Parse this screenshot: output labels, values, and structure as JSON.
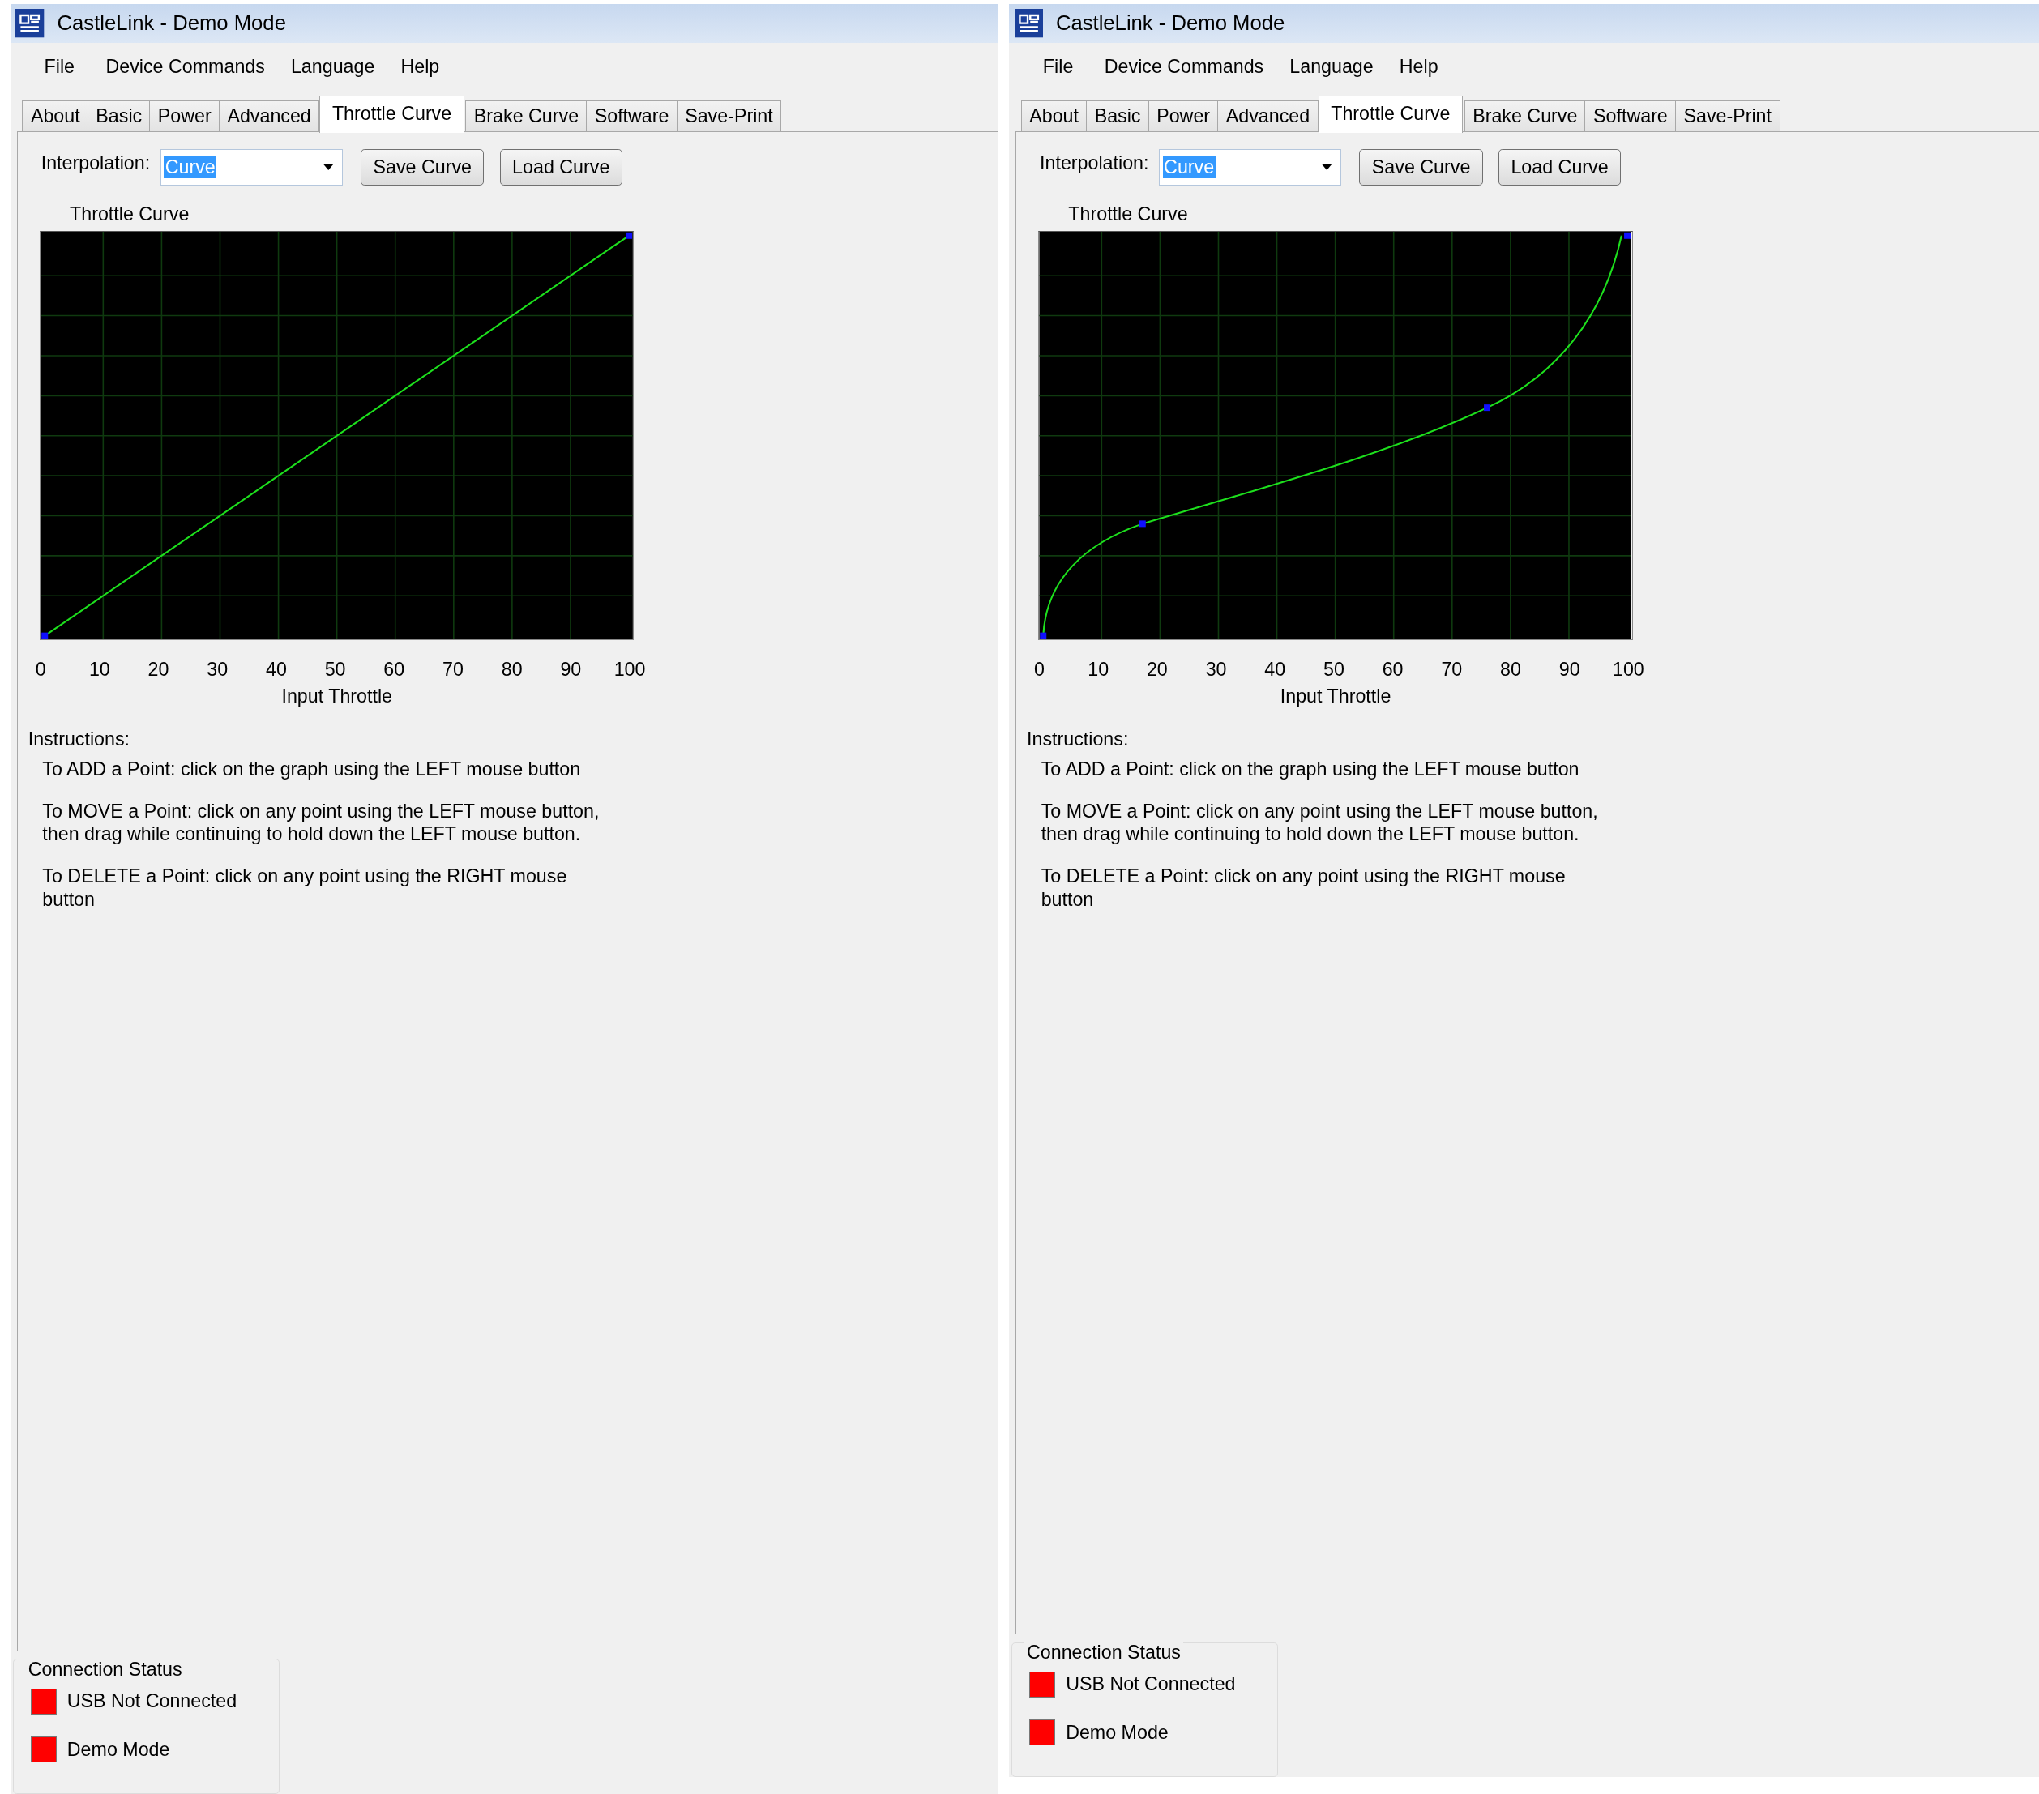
{
  "windows": [
    {
      "title": "CastleLink - Demo Mode",
      "menu": [
        "File",
        "Device Commands",
        "Language",
        "Help"
      ],
      "tabs": [
        {
          "label": "About",
          "selected": false
        },
        {
          "label": "Basic",
          "selected": false
        },
        {
          "label": "Power",
          "selected": false
        },
        {
          "label": "Advanced",
          "selected": false
        },
        {
          "label": "Throttle Curve",
          "selected": true
        },
        {
          "label": "Brake Curve",
          "selected": false
        },
        {
          "label": "Software",
          "selected": false
        },
        {
          "label": "Save-Print",
          "selected": false
        }
      ],
      "interpolation": {
        "label": "Interpolation:",
        "value": "Curve"
      },
      "buttons": [
        "Save Curve",
        "Load Curve"
      ],
      "graph": {
        "title": "Throttle Curve",
        "kind": "linear",
        "x_ticks": [
          "0",
          "10",
          "20",
          "30",
          "40",
          "50",
          "60",
          "70",
          "80",
          "90",
          "100"
        ],
        "xlabel": "Input Throttle"
      },
      "instructions": {
        "heading": "Instructions:",
        "items": [
          "To ADD a Point:  click on the graph using the LEFT mouse button",
          "To MOVE a Point:  click on any point using the LEFT mouse button, then drag while  continuing to hold down the LEFT mouse button.",
          "To DELETE a Point:  click on any point using the RIGHT mouse button"
        ]
      },
      "connection_status": {
        "title": "Connection Status",
        "items": [
          {
            "label": "USB Not Connected",
            "color": "#ff0000"
          },
          {
            "label": "Demo Mode",
            "color": "#ff0000"
          }
        ]
      }
    },
    {
      "title": "CastleLink - Demo Mode",
      "menu": [
        "File",
        "Device Commands",
        "Language",
        "Help"
      ],
      "tabs": [
        {
          "label": "About",
          "selected": false
        },
        {
          "label": "Basic",
          "selected": false
        },
        {
          "label": "Power",
          "selected": false
        },
        {
          "label": "Advanced",
          "selected": false
        },
        {
          "label": "Throttle Curve",
          "selected": true
        },
        {
          "label": "Brake Curve",
          "selected": false
        },
        {
          "label": "Software",
          "selected": false
        },
        {
          "label": "Save-Print",
          "selected": false
        }
      ],
      "interpolation": {
        "label": "Interpolation:",
        "value": "Curve"
      },
      "buttons": [
        "Save Curve",
        "Load Curve"
      ],
      "graph": {
        "title": "Throttle Curve",
        "kind": "s-curve",
        "x_ticks": [
          "0",
          "10",
          "20",
          "30",
          "40",
          "50",
          "60",
          "70",
          "80",
          "90",
          "100"
        ],
        "xlabel": "Input Throttle"
      },
      "instructions": {
        "heading": "Instructions:",
        "items": [
          "To ADD a Point:  click on the graph using the LEFT mouse button",
          "To MOVE a Point:  click on any point using the LEFT mouse button, then drag while  continuing to hold down the LEFT mouse button.",
          "To DELETE a Point:  click on any point using the RIGHT mouse button"
        ]
      },
      "connection_status": {
        "title": "Connection Status",
        "items": [
          {
            "label": "USB Not Connected",
            "color": "#ff0000"
          },
          {
            "label": "Demo Mode",
            "color": "#ff0000"
          }
        ]
      }
    }
  ]
}
